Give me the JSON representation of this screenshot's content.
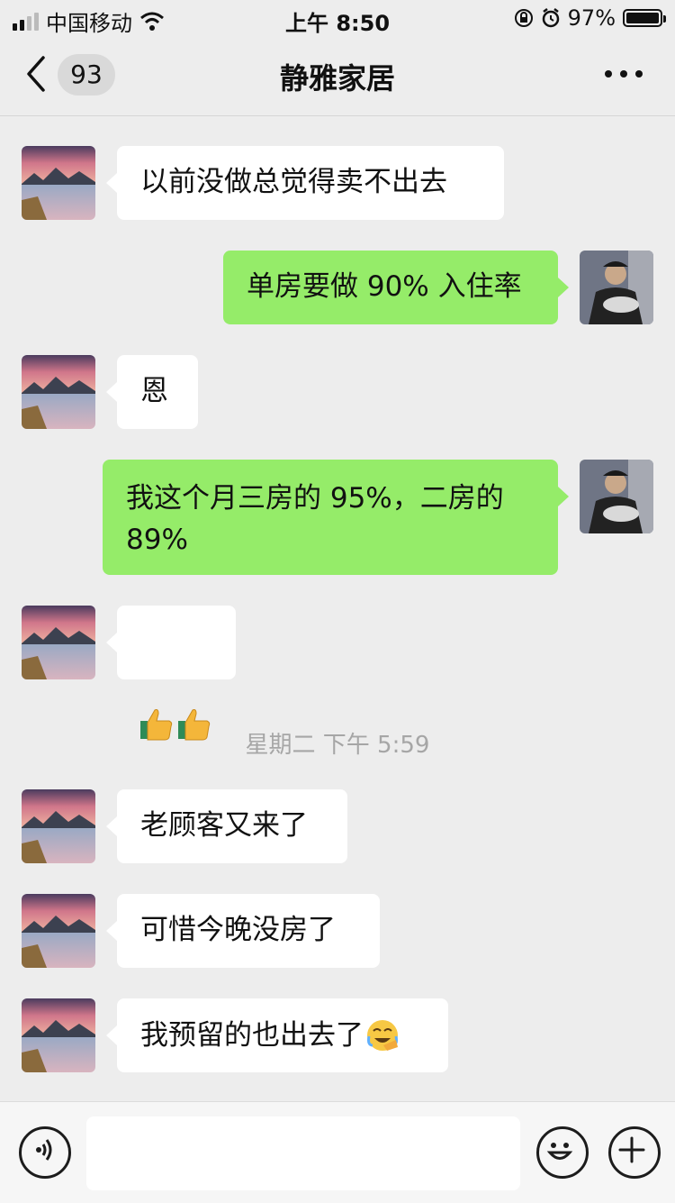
{
  "status_bar": {
    "carrier": "中国移动",
    "time": "上午 8:50",
    "battery": "97%"
  },
  "header": {
    "unread_count": "93",
    "title": "静雅家居"
  },
  "messages": [
    {
      "side": "in",
      "text": "以前没做总觉得卖不出去"
    },
    {
      "side": "out",
      "text": "单房要做 90% 入住率"
    },
    {
      "side": "in",
      "text": "恩"
    },
    {
      "side": "out",
      "text": "我这个月三房的 95%，二房的 89%"
    },
    {
      "side": "in",
      "text": "",
      "emoji": "thumbs-up-icon ×2"
    },
    {
      "side": "in",
      "text": "老顾客又来了"
    },
    {
      "side": "in",
      "text": "可惜今晚没房了"
    },
    {
      "side": "in",
      "text": "我预留的也出去了",
      "emoji": "facepalm-laugh-icon"
    }
  ],
  "timestamp": "星期二 下午 5:59",
  "input": {
    "value": "",
    "placeholder": ""
  },
  "colors": {
    "background": "#ededed",
    "outgoing_bubble": "#95ec69",
    "incoming_bubble": "#ffffff"
  }
}
